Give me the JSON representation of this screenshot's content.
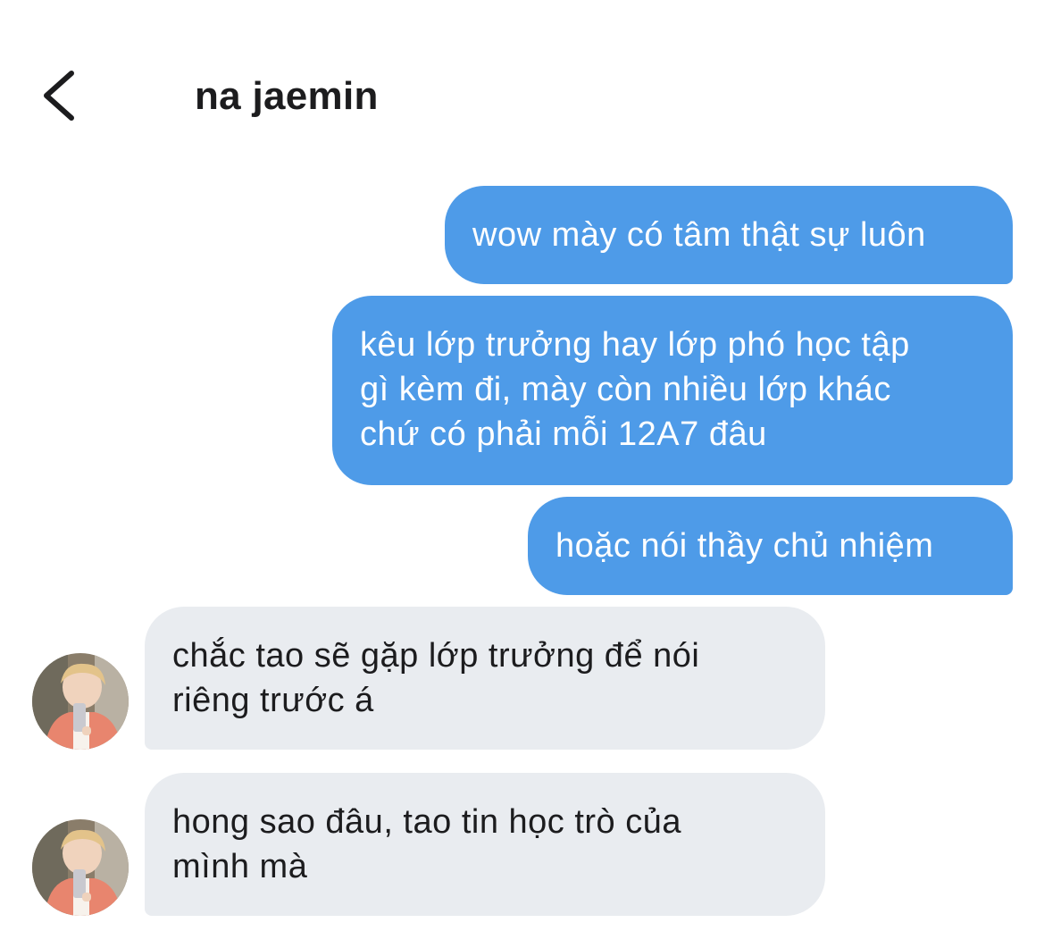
{
  "header": {
    "back_icon": "chevron-left-icon",
    "contact_name": "na jaemin"
  },
  "messages": [
    {
      "direction": "outgoing",
      "text": "wow mày có tâm thật sự luôn"
    },
    {
      "direction": "outgoing",
      "text": "kêu lớp trưởng hay lớp phó học tập\ngì kèm đi, mày còn nhiều lớp khác\nchứ có phải mỗi 12A7 đâu"
    },
    {
      "direction": "outgoing",
      "text": "hoặc nói thầy chủ nhiệm"
    },
    {
      "direction": "incoming",
      "text": "chắc tao sẽ gặp lớp trưởng để nói\nriêng trước á"
    },
    {
      "direction": "incoming",
      "text": "hong sao đâu, tao tin học trò của\nmình mà"
    }
  ],
  "colors": {
    "outgoing_bubble": "#4e9be8",
    "incoming_bubble": "#e9ecf0",
    "text_dark": "#1c1c1e",
    "text_light": "#ffffff"
  }
}
